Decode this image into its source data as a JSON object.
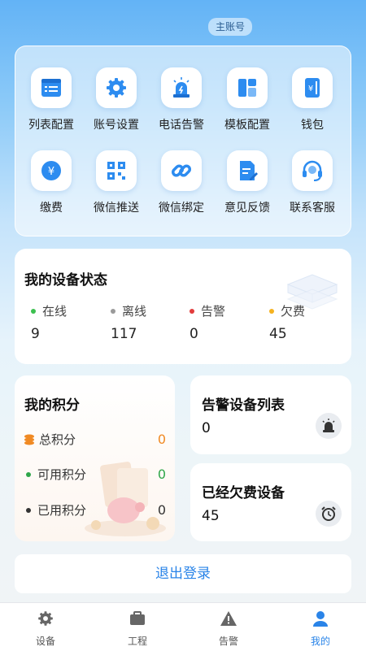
{
  "header": {
    "account_tag": "主账号"
  },
  "quick_menu": [
    {
      "label": "列表配置",
      "icon": "list-config-icon"
    },
    {
      "label": "账号设置",
      "icon": "gear-icon"
    },
    {
      "label": "电话告警",
      "icon": "siren-icon"
    },
    {
      "label": "模板配置",
      "icon": "template-icon"
    },
    {
      "label": "钱包",
      "icon": "wallet-icon"
    },
    {
      "label": "缴费",
      "icon": "yen-coin-icon"
    },
    {
      "label": "微信推送",
      "icon": "qr-code-icon"
    },
    {
      "label": "微信绑定",
      "icon": "link-icon"
    },
    {
      "label": "意见反馈",
      "icon": "feedback-doc-icon"
    },
    {
      "label": "联系客服",
      "icon": "headset-icon"
    }
  ],
  "device_status": {
    "title": "我的设备状态",
    "items": [
      {
        "label": "在线",
        "value": "9",
        "color": "#3cc04f"
      },
      {
        "label": "离线",
        "value": "117",
        "color": "#9a9a9a"
      },
      {
        "label": "告警",
        "value": "0",
        "color": "#e23c3c"
      },
      {
        "label": "欠费",
        "value": "45",
        "color": "#f5b21f"
      }
    ]
  },
  "points": {
    "title": "我的积分",
    "rows": [
      {
        "label": "总积分",
        "value": "0",
        "value_color": "#f08a24"
      },
      {
        "label": "可用积分",
        "value": "0",
        "value_color": "#2fa64a"
      },
      {
        "label": "已用积分",
        "value": "0",
        "value_color": "#333333"
      }
    ]
  },
  "alarm_devices": {
    "title": "告警设备列表",
    "value": "0"
  },
  "overdue_devices": {
    "title": "已经欠费设备",
    "value": "45"
  },
  "logout": {
    "label": "退出登录"
  },
  "tabs": [
    {
      "label": "设备",
      "icon": "gear-icon",
      "active": false
    },
    {
      "label": "工程",
      "icon": "briefcase-icon",
      "active": false
    },
    {
      "label": "告警",
      "icon": "warning-icon",
      "active": false
    },
    {
      "label": "我的",
      "icon": "person-icon",
      "active": true
    }
  ],
  "colors": {
    "accent": "#2a84e8",
    "icon_blue": "#2d8cf0"
  }
}
